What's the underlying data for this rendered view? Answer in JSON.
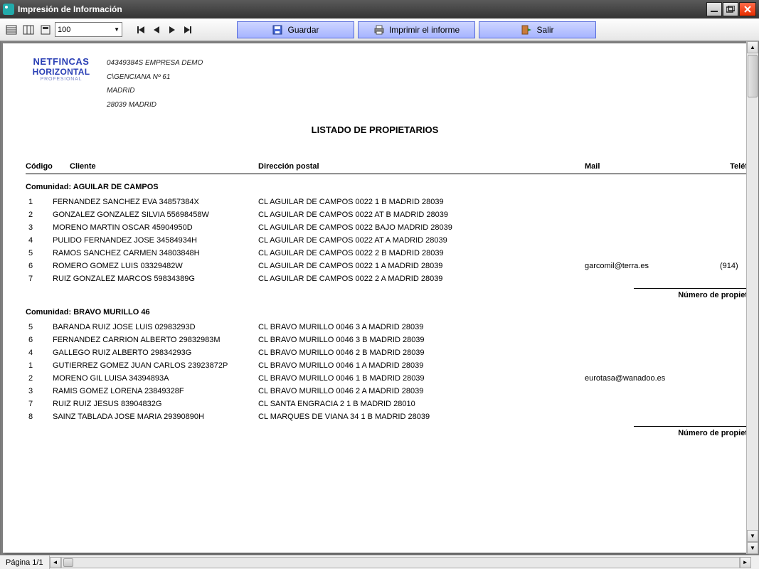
{
  "window": {
    "title": "Impresión de Información"
  },
  "toolbar": {
    "zoom": "100",
    "save_label": "Guardar",
    "print_label": "Imprimir el informe",
    "exit_label": "Salir"
  },
  "letterhead": {
    "logo_line1": "NETFINCAS",
    "logo_line2": "HORIZONTAL",
    "logo_line3": "PROFESIONAL",
    "company_id": "04349384S EMPRESA DEMO",
    "address1": "C\\GENCIANA Nº 61",
    "city": "MADRID",
    "postal": "28039 MADRID"
  },
  "report": {
    "title": "LISTADO DE PROPIETARIOS"
  },
  "columns": {
    "code": "Código",
    "client": "Cliente",
    "address": "Dirección postal",
    "mail": "Mail",
    "tel": "Teléf"
  },
  "groups": [
    {
      "title": "Comunidad: AGUILAR DE CAMPOS",
      "rows": [
        {
          "code": "1",
          "client": "FERNANDEZ SANCHEZ EVA  34857384X",
          "address": "CL AGUILAR DE CAMPOS 0022 1 B MADRID 28039",
          "mail": "",
          "tel": ""
        },
        {
          "code": "2",
          "client": "GONZALEZ GONZALEZ SILVIA  55698458W",
          "address": "CL AGUILAR DE CAMPOS 0022 AT B MADRID 28039",
          "mail": "",
          "tel": ""
        },
        {
          "code": "3",
          "client": "MORENO MARTIN OSCAR  45904950D",
          "address": "CL AGUILAR DE CAMPOS 0022 BAJO  MADRID 28039",
          "mail": "",
          "tel": ""
        },
        {
          "code": "4",
          "client": "PULIDO FERNANDEZ JOSE  34584934H",
          "address": "CL AGUILAR DE CAMPOS 0022 AT A MADRID 28039",
          "mail": "",
          "tel": ""
        },
        {
          "code": "5",
          "client": "RAMOS SANCHEZ CARMEN  34803848H",
          "address": "CL AGUILAR DE CAMPOS 0022 2 B MADRID 28039",
          "mail": "",
          "tel": ""
        },
        {
          "code": "6",
          "client": "ROMERO GOMEZ LUIS  03329482W",
          "address": "CL AGUILAR DE CAMPOS 0022 1 A MADRID 28039",
          "mail": "garcomil@terra.es",
          "tel": "(914)"
        },
        {
          "code": "7",
          "client": "RUIZ GONZALEZ MARCOS  59834389G",
          "address": "CL AGUILAR DE CAMPOS 0022 2 A MADRID 28039",
          "mail": "",
          "tel": ""
        }
      ],
      "footer": "Número de propiet"
    },
    {
      "title": "Comunidad: BRAVO MURILLO 46",
      "rows": [
        {
          "code": "5",
          "client": "BARANDA RUIZ JOSE LUIS  02983293D",
          "address": "CL BRAVO MURILLO 0046 3 A MADRID 28039",
          "mail": "",
          "tel": ""
        },
        {
          "code": "6",
          "client": "FERNANDEZ CARRION ALBERTO  29832983M",
          "address": "CL BRAVO MURILLO 0046 3 B MADRID 28039",
          "mail": "",
          "tel": ""
        },
        {
          "code": "4",
          "client": "GALLEGO RUIZ ALBERTO  29834293G",
          "address": "CL BRAVO MURILLO 0046 2 B MADRID 28039",
          "mail": "",
          "tel": ""
        },
        {
          "code": "1",
          "client": "GUTIERREZ GOMEZ JUAN CARLOS  23923872P",
          "address": "CL BRAVO MURILLO 0046 1 A MADRID 28039",
          "mail": "",
          "tel": ""
        },
        {
          "code": "2",
          "client": "MORENO GIL LUISA  34394893A",
          "address": "CL BRAVO MURILLO 0046 1 B MADRID 28039",
          "mail": "eurotasa@wanadoo.es",
          "tel": ""
        },
        {
          "code": "3",
          "client": "RAMIS GOMEZ LORENA  23849328F",
          "address": "CL BRAVO MURILLO 0046 2 A MADRID 28039",
          "mail": "",
          "tel": ""
        },
        {
          "code": "7",
          "client": "RUIZ RUIZ JESUS  83904832G",
          "address": "CL SANTA ENGRACIA 2 1 B MADRID 28010",
          "mail": "",
          "tel": ""
        },
        {
          "code": "8",
          "client": "SAINZ TABLADA JOSE MARIA  29390890H",
          "address": "CL MARQUES DE VIANA 34 1 B MADRID 28039",
          "mail": "",
          "tel": ""
        }
      ],
      "footer": "Número de propiet"
    }
  ],
  "status": {
    "page": "Página 1/1"
  }
}
